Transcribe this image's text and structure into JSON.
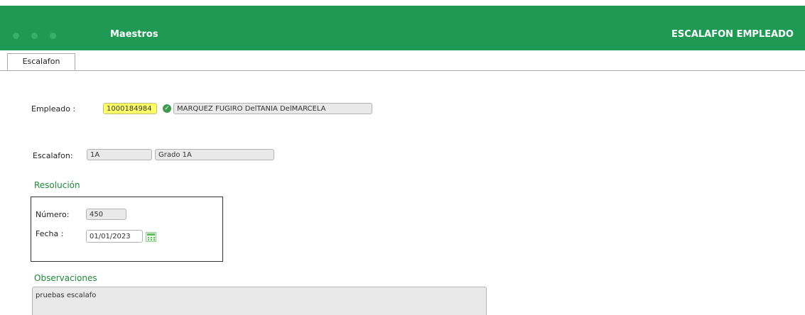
{
  "header": {
    "module_title": "Maestros",
    "page_title": "ESCALAFON EMPLEADO",
    "accent_color": "#1e9a55"
  },
  "tabs": [
    {
      "label": "Escalafon",
      "active": true
    }
  ],
  "empleado": {
    "label": "Empleado :",
    "id_value": "1000184984",
    "name_value": "MARQUEZ FUGIRO DelTANIA DelMARCELA",
    "lookup_icon": "green-lookup-icon"
  },
  "escalafon": {
    "label": "Escalafon:",
    "code_value": "1A",
    "name_value": "Grado 1A"
  },
  "resolucion": {
    "section_title": "Resolución",
    "numero_label": "Número:",
    "numero_value": "450",
    "fecha_label": "Fecha :",
    "fecha_value": "01/01/2023",
    "calendar_icon": "calendar-icon"
  },
  "observaciones": {
    "section_title": "Observaciones",
    "value": "pruebas escalafo"
  }
}
